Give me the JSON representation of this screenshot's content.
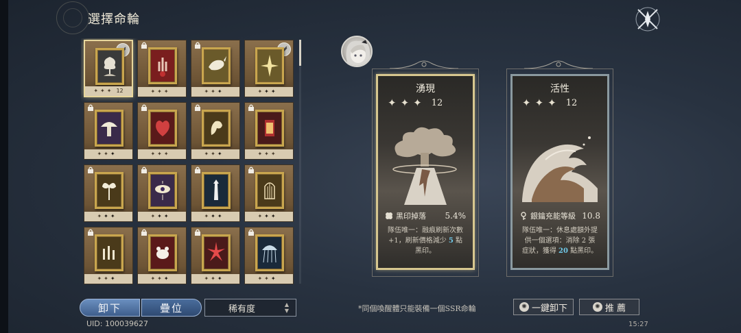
{
  "header": {
    "title": "選擇命輪"
  },
  "grid": {
    "cards": [
      {
        "locked": false,
        "selected": true,
        "badge": true,
        "stars": 3,
        "count": "12",
        "art": "tree"
      },
      {
        "locked": true,
        "selected": false,
        "badge": false,
        "stars": 3,
        "count": "",
        "art": "hand"
      },
      {
        "locked": true,
        "selected": false,
        "badge": false,
        "stars": 2,
        "count": "",
        "art": "whale"
      },
      {
        "locked": false,
        "selected": false,
        "badge": true,
        "stars": 1,
        "count": "",
        "art": "spark"
      },
      {
        "locked": true,
        "selected": false,
        "badge": false,
        "stars": 2,
        "count": "",
        "art": "mushroom"
      },
      {
        "locked": true,
        "selected": false,
        "badge": false,
        "stars": 3,
        "count": "",
        "art": "heart"
      },
      {
        "locked": true,
        "selected": false,
        "badge": false,
        "stars": 2,
        "count": "",
        "art": "hand2"
      },
      {
        "locked": true,
        "selected": false,
        "badge": false,
        "stars": 3,
        "count": "",
        "art": "lantern"
      },
      {
        "locked": true,
        "selected": false,
        "badge": false,
        "stars": 1,
        "count": "",
        "art": "lily"
      },
      {
        "locked": true,
        "selected": false,
        "badge": false,
        "stars": 1,
        "count": "",
        "art": "eye"
      },
      {
        "locked": true,
        "selected": false,
        "badge": false,
        "stars": 1,
        "count": "",
        "art": "tower"
      },
      {
        "locked": true,
        "selected": false,
        "badge": false,
        "stars": 1,
        "count": "",
        "art": "cage"
      },
      {
        "locked": true,
        "selected": false,
        "badge": false,
        "stars": 2,
        "count": "",
        "art": "candles"
      },
      {
        "locked": true,
        "selected": false,
        "badge": false,
        "stars": 2,
        "count": "",
        "art": "rat"
      },
      {
        "locked": true,
        "selected": false,
        "badge": false,
        "stars": 2,
        "count": "",
        "art": "burst"
      },
      {
        "locked": true,
        "selected": false,
        "badge": false,
        "stars": 2,
        "count": "",
        "art": "jelly"
      }
    ]
  },
  "controls": {
    "unequip_label": "卸下",
    "stack_label": "疊位",
    "rarity_label": "稀有度",
    "uid": "UID: 100039627"
  },
  "panels": {
    "left": {
      "name": "湧現",
      "level": "12",
      "stat_label": "黑印掉落",
      "stat_value": "5.4%",
      "desc_1": "隊伍唯一：融痕刷新次數",
      "desc_2": "+1，刷新價格減少",
      "desc_hl": "5",
      "desc_3": "點",
      "desc_4": "黑印。"
    },
    "right": {
      "name": "活性",
      "level": "12",
      "stat_label": "銀鑰充能等級",
      "stat_value": "10.8",
      "desc_1": "隊伍唯一：休息處額外提",
      "desc_2": "供一個選項：消除 2 張",
      "desc_3": "症狀，獲得",
      "desc_hl": "20",
      "desc_4": "點黑印。"
    }
  },
  "footer": {
    "note": "*同個喚醒體只能裝備一個SSR命輪",
    "auto_unequip": "一鍵卸下",
    "recommend": "推 薦",
    "time": "15:27"
  },
  "colors": {
    "accent_blue": "#5a7fb0",
    "highlight_cyan": "#6fc8e8",
    "gold_frame": "#c9a64e"
  }
}
